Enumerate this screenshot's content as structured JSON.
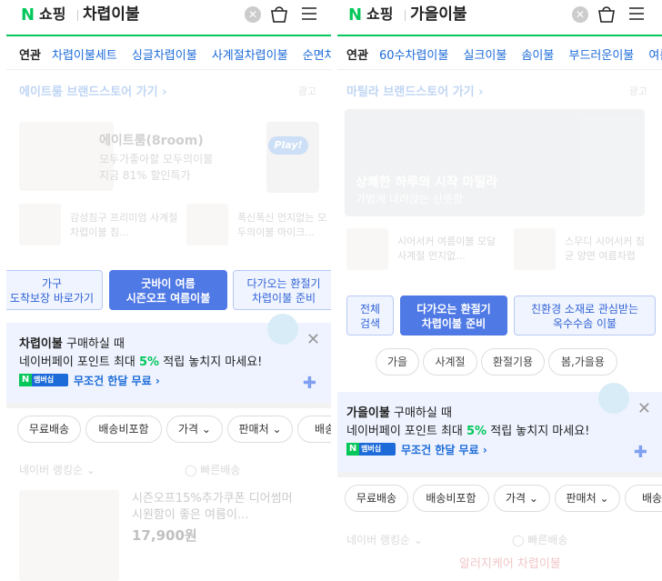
{
  "left": {
    "brand": "쇼핑",
    "query": "차렵이불",
    "related_label": "연관",
    "related": [
      "차렵이불세트",
      "싱글차렵이불",
      "사계절차렵이불",
      "순면차렵이불"
    ],
    "store_link": "에이트룸 브랜드스토어 가기",
    "ad_label": "광고",
    "big_title": "에이트룸(8room)",
    "big_sub1": "모두가좋아할 모두의이불",
    "big_sub2": "지금 81% 할인특가",
    "play": "Play!",
    "small1": "감성침구 프리미엄 사계절 차렵이불 침...",
    "small2": "폭신폭신 먼지없는 모두의이불 마이크...",
    "chips": [
      {
        "label": "가구\n도착보장 바로가기"
      },
      {
        "label": "굿바이 여름\n시즌오프 여름이불"
      },
      {
        "label": "다가오는 환절기\n차렵이불 준비"
      }
    ],
    "promo_keyword": "차렵이불",
    "promo_line1": "구매하실 때",
    "promo_line2_pre": "네이버페이 포인트 최대",
    "promo_pct": "5%",
    "promo_line2_post": "적립 놓치지 마세요!",
    "promo_link": "무조건 한달 무료",
    "membership": "멤버십",
    "filters": [
      "무료배송",
      "배송비포함",
      "가격",
      "판매처",
      "배송"
    ],
    "rank": "네이버 랭킹순",
    "fast": "빠른배송",
    "product_title": "시즌오프15%추가쿠폰 디어썸머 시원함이 좋은 여름이...",
    "price": "17,900원"
  },
  "right": {
    "brand": "쇼핑",
    "query": "가을이불",
    "related_label": "연관",
    "related": [
      "60수차렵이불",
      "실크이불",
      "솜이불",
      "부드러운이불",
      "여름"
    ],
    "store_link": "마틸라 브랜드스토어 가기",
    "ad_label": "광고",
    "hero_title": "상쾌한 하루의 시작 마틸라",
    "hero_sub": "가볍게 내려앉는 산뜻함",
    "small1": "시어서커 여름이불 모달 사계절 먼지없...",
    "small2": "스무디 시어서커 침 균 양면 여름차렵",
    "chips": [
      {
        "label": "전체\n검색"
      },
      {
        "label": "다가오는 환절기\n차렵이불 준비"
      },
      {
        "label": "친환경 소재로 관심받는\n옥수수솜 이불"
      }
    ],
    "pills": [
      "가을",
      "사계절",
      "환절기용",
      "봄,가을용"
    ],
    "promo_keyword": "가을이불",
    "promo_line1": "구매하실 때",
    "promo_line2_pre": "네이버페이 포인트 최대",
    "promo_pct": "5%",
    "promo_line2_post": "적립 놓치지 마세요!",
    "promo_link": "무조건 한달 무료",
    "membership": "멤버십",
    "filters": [
      "무료배송",
      "배송비포함",
      "가격",
      "판매처",
      "배송"
    ],
    "rank": "네이버 랭킹순",
    "fast": "빠른배송",
    "product_title": "알러지케어 차렵이불"
  }
}
